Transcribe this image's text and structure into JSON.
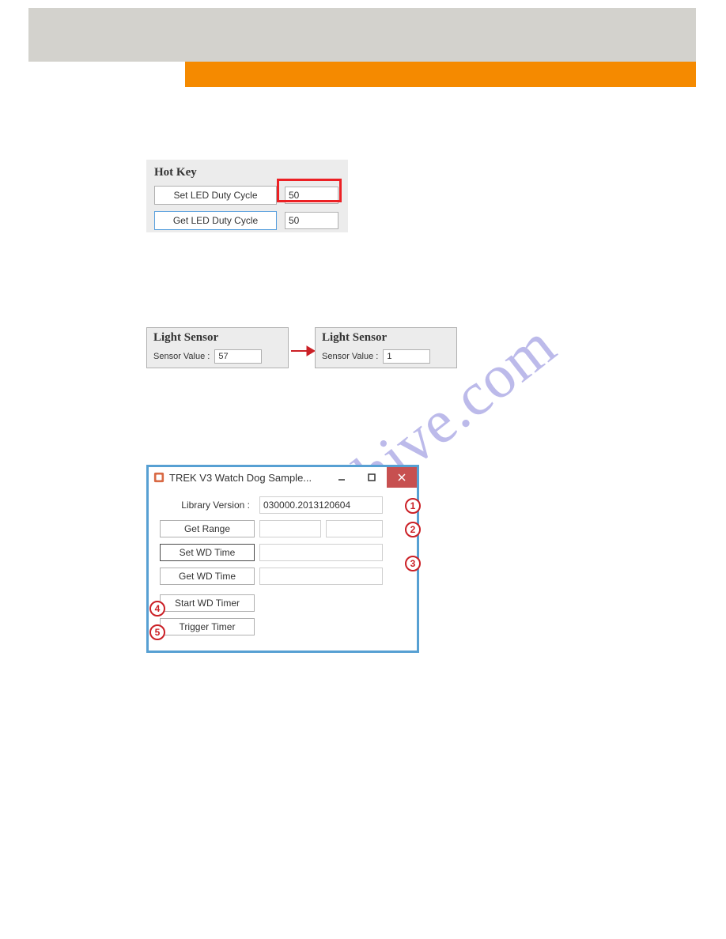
{
  "top": {},
  "watermark": "manualshive.com",
  "hotkey": {
    "title": "Hot Key",
    "set_btn": "Set LED Duty Cycle",
    "set_val": "50",
    "get_btn": "Get LED Duty Cycle",
    "get_val": "50"
  },
  "light_sensor": {
    "title": "Light Sensor",
    "label": "Sensor Value :",
    "left_val": "57",
    "right_val": "1"
  },
  "watchdog": {
    "win_title": "TREK V3 Watch Dog Sample...",
    "lib_label": "Library Version :",
    "lib_val": "030000.2013120604",
    "get_range": "Get Range",
    "range_lo": "",
    "range_hi": "",
    "set_wd": "Set WD Time",
    "set_wd_val": "",
    "get_wd": "Get WD Time",
    "get_wd_val": "",
    "start_timer": "Start WD Timer",
    "trigger_timer": "Trigger Timer",
    "callouts": {
      "c1": "1",
      "c2": "2",
      "c3": "3",
      "c4": "4",
      "c5": "5"
    }
  }
}
